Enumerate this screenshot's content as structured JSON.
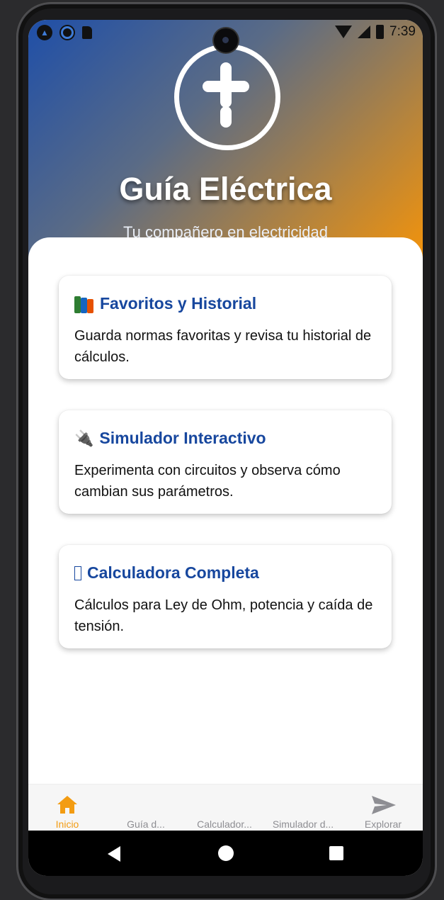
{
  "status_bar": {
    "time": "7:39",
    "icons": [
      "app-icon",
      "sync-icon",
      "sd-card-icon",
      "wifi-icon",
      "signal-icon",
      "battery-icon"
    ]
  },
  "header": {
    "logo_icon": "plus-circle-logo",
    "title": "Guía Eléctrica",
    "subtitle": "Tu compañero en electricidad"
  },
  "cards": [
    {
      "icon": "books-icon",
      "title": "Favoritos y Historial",
      "description": "Guarda normas favoritas y revisa tu historial de cálculos."
    },
    {
      "icon": "plug-icon",
      "title": "Simulador Interactivo",
      "description": "Experimenta con circuitos y observa cómo cambian sus parámetros."
    },
    {
      "icon": "missing-glyph-icon",
      "title": "Calculadora Completa",
      "description": "Cálculos para Ley de Ohm, potencia y caída de tensión."
    }
  ],
  "tabs": [
    {
      "label": "Inicio",
      "icon": "home-icon",
      "active": true
    },
    {
      "label": "Guía d...",
      "active": false
    },
    {
      "label": "Calculador...",
      "active": false
    },
    {
      "label": "Simulador d...",
      "active": false
    },
    {
      "label": "Explorar",
      "icon": "send-icon",
      "active": false
    }
  ],
  "colors": {
    "accent_orange": "#f39c12",
    "card_title_blue": "#17479e",
    "gradient_start": "#1f4fa8",
    "gradient_end": "#f3930b"
  }
}
